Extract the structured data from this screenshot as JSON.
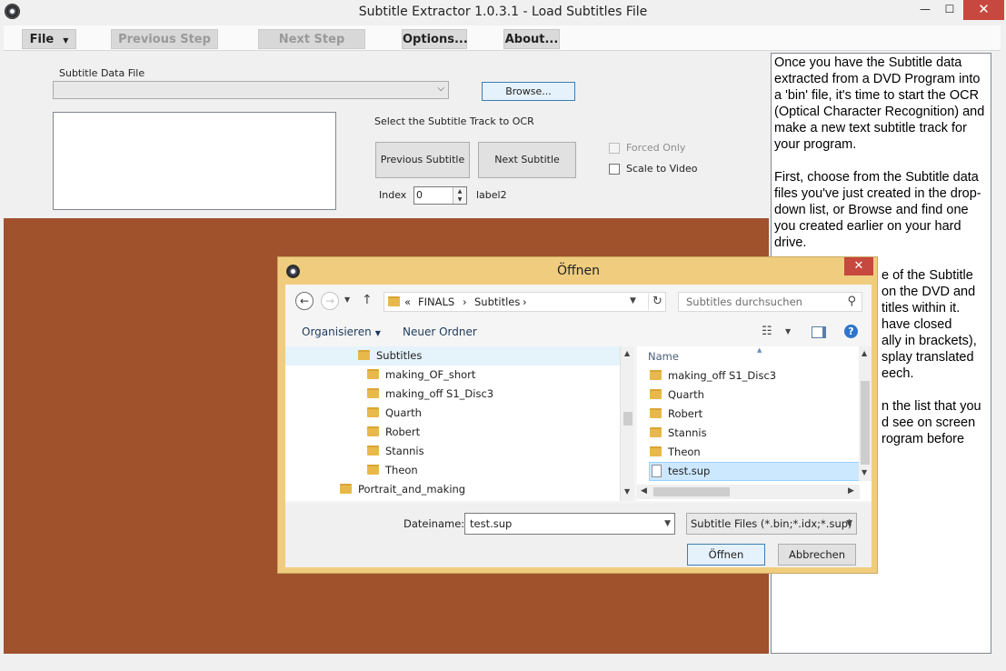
{
  "window": {
    "title": "Subtitle Extractor 1.0.3.1 - Load Subtitles File",
    "minimize": "—",
    "maximize": "☐",
    "close": "✕"
  },
  "toolbar": {
    "file": "File",
    "previous_step": "Previous Step",
    "next_step": "Next Step",
    "options": "Options...",
    "about": "About..."
  },
  "form": {
    "subtitle_data_file_label": "Subtitle Data File",
    "subtitle_data_file_value": "",
    "browse_button": "Browse...",
    "track_label": "Select the Subtitle Track to OCR",
    "previous_subtitle": "Previous Subtitle",
    "next_subtitle": "Next Subtitle",
    "forced_only": "Forced Only",
    "forced_only_checked": false,
    "forced_only_enabled": false,
    "scale_to_video": "Scale to Video",
    "scale_to_video_checked": false,
    "index_label": "Index",
    "index_value": "0",
    "label2": "label2"
  },
  "colors": {
    "brown_area": "#a0522d",
    "dialog_frame": "#f0cd7e"
  },
  "help_text": {
    "p1": "Once you have the Subtitle data extracted from a DVD Program into a 'bin' file, it's time to start the OCR (Optical Character Recognition) and make a new text subtitle track for your program.",
    "p2": "First, choose from the Subtitle data files you've just created in the drop-down list, or Browse and find one you created earlier on your hard drive.",
    "p3_fragments": [
      "e of the Subtitle",
      "on the DVD and",
      "titles within it.",
      "have closed",
      "ally in brackets),",
      "splay translated",
      "eech."
    ],
    "p4_fragments": [
      "n the list that you",
      "d see on screen",
      "rogram before"
    ]
  },
  "dialog": {
    "title": "Öffnen",
    "close": "✕",
    "address": {
      "overflow": "«",
      "crumbs": [
        "FINALS",
        "Subtitles"
      ],
      "separator": "›"
    },
    "search_placeholder": "Subtitles durchsuchen",
    "organize": "Organisieren",
    "new_folder": "Neuer Ordner",
    "help": "?",
    "tree": [
      {
        "label": "Subtitles",
        "level": 1
      },
      {
        "label": "making_OF_short",
        "level": 2
      },
      {
        "label": "making_off S1_Disc3",
        "level": 2
      },
      {
        "label": "Quarth",
        "level": 2
      },
      {
        "label": "Robert",
        "level": 2
      },
      {
        "label": "Stannis",
        "level": 2
      },
      {
        "label": "Theon",
        "level": 2
      },
      {
        "label": "Portrait_and_making",
        "level": 0
      }
    ],
    "list_header": "Name",
    "list_items": [
      {
        "label": "making_off S1_Disc3",
        "type": "folder"
      },
      {
        "label": "Quarth",
        "type": "folder"
      },
      {
        "label": "Robert",
        "type": "folder"
      },
      {
        "label": "Stannis",
        "type": "folder"
      },
      {
        "label": "Theon",
        "type": "folder"
      },
      {
        "label": "test.sup",
        "type": "file",
        "selected": true
      }
    ],
    "filename_label": "Dateiname:",
    "filename_value": "test.sup",
    "filetype_value": "Subtitle Files (*.bin;*.idx;*.sup)",
    "open_button": "Öffnen",
    "cancel_button": "Abbrechen"
  }
}
